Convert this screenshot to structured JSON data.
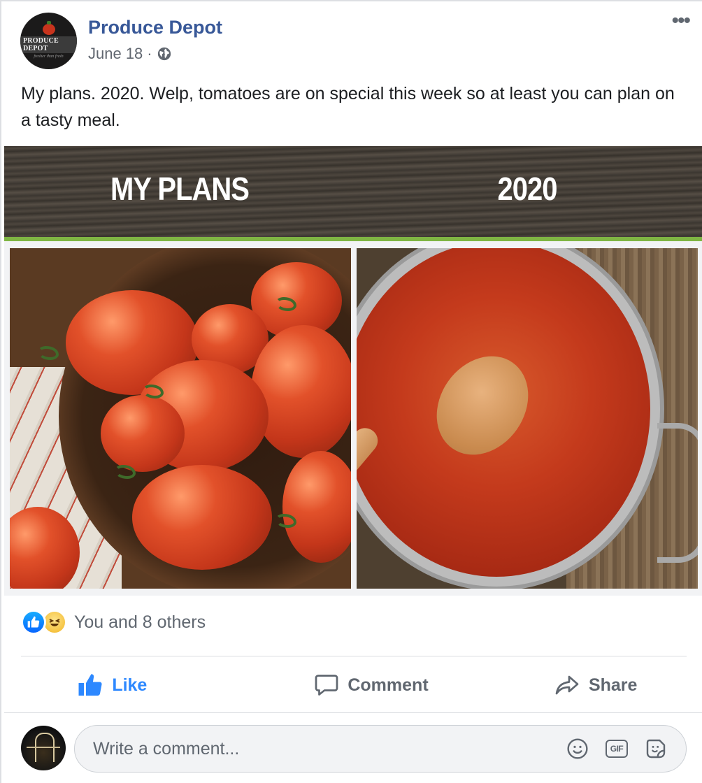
{
  "post": {
    "page_name": "Produce Depot",
    "date": "June 18",
    "separator": "·",
    "privacy_icon": "globe-icon",
    "more_icon": "more-options-icon",
    "text": "My plans. 2020. Welp, tomatoes are on special this week so at least you can plan on a tasty meal.",
    "avatar": {
      "brand": "PRODUCE DEPOT",
      "tagline": "fresher than fresh"
    }
  },
  "image": {
    "banner_left": "MY PLANS",
    "banner_right": "2020",
    "accent_color": "#7fb543"
  },
  "reactions": {
    "icons": [
      "like-icon",
      "haha-icon"
    ],
    "text": "You and 8 others"
  },
  "actions": {
    "like": "Like",
    "comment": "Comment",
    "share": "Share",
    "like_color": "#2d88ff"
  },
  "composer": {
    "placeholder": "Write a comment...",
    "gif_label": "GIF",
    "icons": [
      "emoji-icon",
      "gif-icon",
      "sticker-icon"
    ]
  },
  "colors": {
    "page_name": "#385898",
    "meta": "#616770",
    "text": "#1c1e21"
  }
}
